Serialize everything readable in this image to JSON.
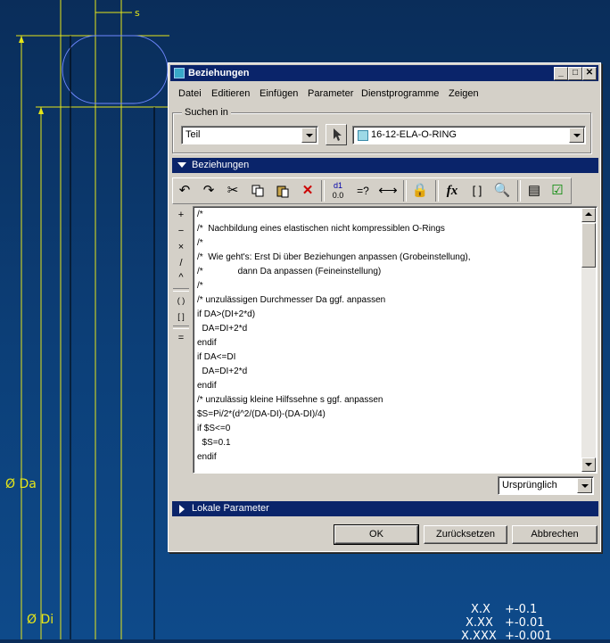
{
  "cad": {
    "dim_s": "s",
    "dim_da": "Ø Da",
    "dim_di": "Ø Di",
    "tolerance_rows": [
      {
        "format": "X.X",
        "value": "+-0.1"
      },
      {
        "format": "X.XX",
        "value": "+-0.01"
      },
      {
        "format": "X.XXX",
        "value": "+-0.001"
      }
    ]
  },
  "dialog": {
    "title": "Beziehungen",
    "window_buttons": {
      "minimize": "_",
      "maximize": "□",
      "close": "✕"
    },
    "menu": [
      "Datei",
      "Editieren",
      "Einfügen",
      "Parameter",
      "Dienstprogramme",
      "Zeigen"
    ],
    "search": {
      "group_label": "Suchen in",
      "scope_value": "Teil",
      "model_value": "16-12-ELA-O-RING"
    },
    "relations_section": "Beziehungen",
    "toolbar_icons": [
      "undo-icon",
      "redo-icon",
      "cut-icon",
      "copy-icon",
      "paste-icon",
      "delete-icon",
      "sort-relations-icon",
      "evaluate-icon",
      "insert-dimension-icon",
      "local-parameters-icon",
      "function-icon",
      "parentheses-icon",
      "verify-icon",
      "show-values-icon",
      "check-icon"
    ],
    "toolbar_glyphs": {
      "evaluate": "=?",
      "function": "fx",
      "parentheses": "[ ]"
    },
    "operators": [
      "+",
      "−",
      "×",
      "/",
      "^",
      "( )",
      "[ ]",
      "="
    ],
    "code_lines": [
      "/*",
      "/*  Nachbildung eines elastischen nicht kompressiblen O-Rings",
      "/*",
      "/*  Wie geht's: Erst Di über Beziehungen anpassen (Grobeinstellung),",
      "/*              dann Da anpassen (Feineinstellung)",
      "/*",
      "/* unzulässigen Durchmesser Da ggf. anpassen",
      "if DA>(DI+2*d)",
      "  DA=DI+2*d",
      "endif",
      "if DA<=DI",
      "  DA=DI+2*d",
      "endif",
      "/* unzulässig kleine Hilfssehne s ggf. anpassen",
      "$S=Pi/2*(d^2/(DA-DI)-(DA-DI)/4)",
      "if $S<=0",
      "  $S=0.1",
      "endif"
    ],
    "display_mode": "Ursprünglich",
    "local_params_section": "Lokale Parameter",
    "buttons": {
      "ok": "OK",
      "reset": "Zurücksetzen",
      "cancel": "Abbrechen"
    },
    "colors": {
      "title_bg": "#0a246a",
      "face": "#d4d0c8",
      "cad_yellow": "#e6e619",
      "cad_bg": "#0c3f78"
    }
  }
}
